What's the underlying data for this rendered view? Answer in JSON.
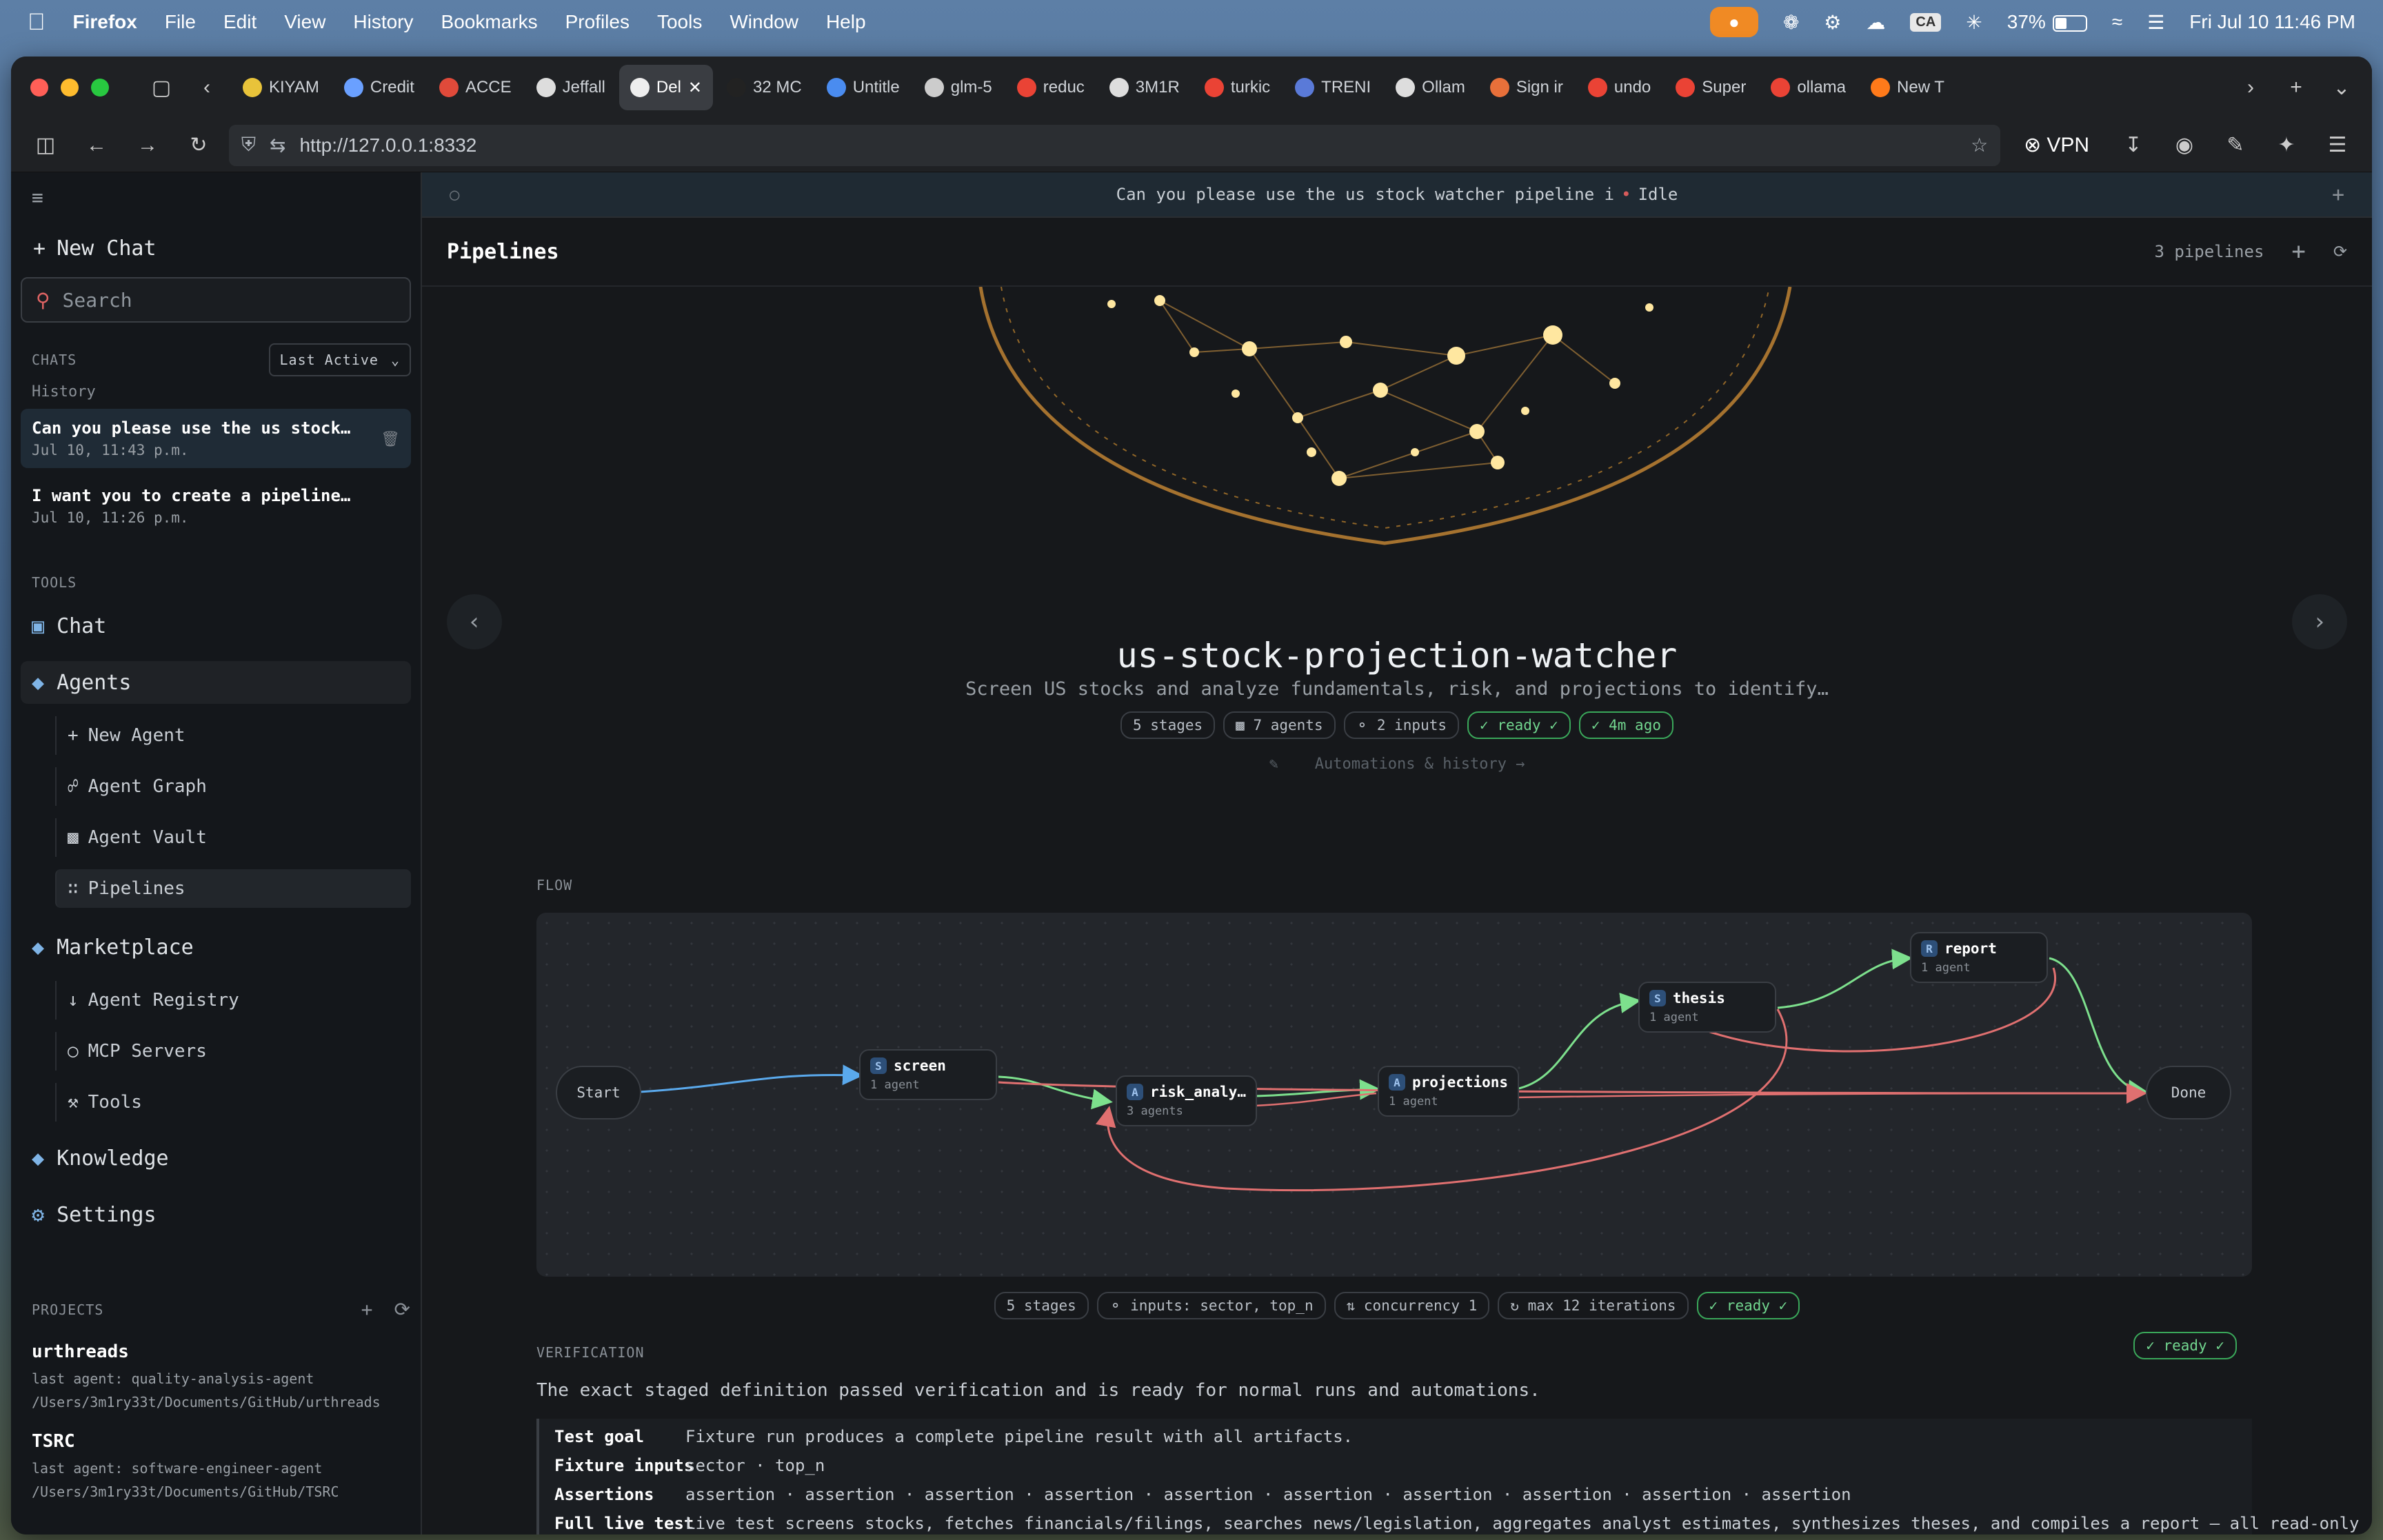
{
  "menubar": {
    "app": "Firefox",
    "items": [
      "File",
      "Edit",
      "View",
      "History",
      "Bookmarks",
      "Profiles",
      "Tools",
      "Window",
      "Help"
    ],
    "battery": "37%",
    "clock": "Fri Jul 10  11:46 PM",
    "ca": "CA"
  },
  "tabs": [
    {
      "label": "KIYAM"
    },
    {
      "label": "Credit"
    },
    {
      "label": "ACCE"
    },
    {
      "label": "Jeffall"
    },
    {
      "label": "Del",
      "active": true
    },
    {
      "label": "32 MC"
    },
    {
      "label": "Untitle"
    },
    {
      "label": "glm-5"
    },
    {
      "label": "reduc"
    },
    {
      "label": "3M1R"
    },
    {
      "label": "turkic"
    },
    {
      "label": "TRENI"
    },
    {
      "label": "Ollam"
    },
    {
      "label": "Sign ir"
    },
    {
      "label": "undo"
    },
    {
      "label": "Super"
    },
    {
      "label": "ollama"
    },
    {
      "label": "New T"
    }
  ],
  "url": "http://127.0.0.1:8332",
  "vpn_label": "VPN",
  "sidebar": {
    "new_chat": "New Chat",
    "search_placeholder": "Search",
    "chats_label": "CHATS",
    "sort_label": "Last Active",
    "history_label": "History",
    "chats": [
      {
        "title": "Can you please use the us stock…",
        "date": "Jul 10, 11:43 p.m."
      },
      {
        "title": "I want you to create a pipeline…",
        "date": "Jul 10, 11:26 p.m."
      }
    ],
    "tools_label": "TOOLS",
    "chat": "Chat",
    "agents": "Agents",
    "agent_items": [
      "New Agent",
      "Agent Graph",
      "Agent Vault",
      "Pipelines"
    ],
    "marketplace": "Marketplace",
    "market_items": [
      "Agent Registry",
      "MCP Servers",
      "Tools"
    ],
    "knowledge": "Knowledge",
    "settings": "Settings",
    "projects_label": "PROJECTS",
    "projects": [
      {
        "name": "urthreads",
        "agent": "last agent: quality-analysis-agent",
        "path": "/Users/3m1ry33t/Documents/GitHub/urthreads"
      },
      {
        "name": "TSRC",
        "agent": "last agent: software-engineer-agent",
        "path": "/Users/3m1ry33t/Documents/GitHub/TSRC"
      }
    ]
  },
  "topbar": {
    "text": "Can you please use the us stock watcher pipeline i",
    "status": "Idle"
  },
  "pipelines": {
    "title": "Pipelines",
    "count": "3 pipelines",
    "name": "us-stock-projection-watcher",
    "description": "Screen US stocks and analyze fundamentals, risk, and projections to identify…",
    "chips": [
      "5 stages",
      "7 agents",
      "2 inputs",
      "ready ✓",
      "4m ago"
    ],
    "automations": "Automations & history →"
  },
  "flow": {
    "label": "FLOW",
    "start": "Start",
    "done": "Done",
    "nodes": [
      {
        "badge": "S",
        "name": "screen",
        "agents": "1 agent"
      },
      {
        "badge": "A",
        "name": "risk_analy…",
        "agents": "3 agents"
      },
      {
        "badge": "A",
        "name": "projections",
        "agents": "1 agent"
      },
      {
        "badge": "S",
        "name": "thesis",
        "agents": "1 agent"
      },
      {
        "badge": "R",
        "name": "report",
        "agents": "1 agent"
      }
    ],
    "chips": [
      "5 stages",
      "inputs: sector, top_n",
      "concurrency 1",
      "max 12 iterations",
      "ready ✓"
    ]
  },
  "verification": {
    "label": "VERIFICATION",
    "badge": "✓ ready ✓",
    "text": "The exact staged definition passed verification and is ready for normal runs and automations.",
    "rows": [
      {
        "k": "Test goal",
        "v": "Fixture run produces a complete pipeline result with all artifacts."
      },
      {
        "k": "Fixture inputs",
        "v": "sector · top_n"
      },
      {
        "k": "Assertions",
        "v": "assertion · assertion · assertion · assertion · assertion · assertion · assertion · assertion · assertion · assertion"
      },
      {
        "k": "Full live test",
        "v": "Live test screens stocks, fetches financials/filings, searches news/legislation, aggregates analyst estimates, synthesizes theses, and compiles a report — all read-only"
      }
    ]
  },
  "colors": {
    "accent_green": "#72d68f",
    "edge_blue": "#5aa9ec",
    "edge_red": "#e07070"
  }
}
